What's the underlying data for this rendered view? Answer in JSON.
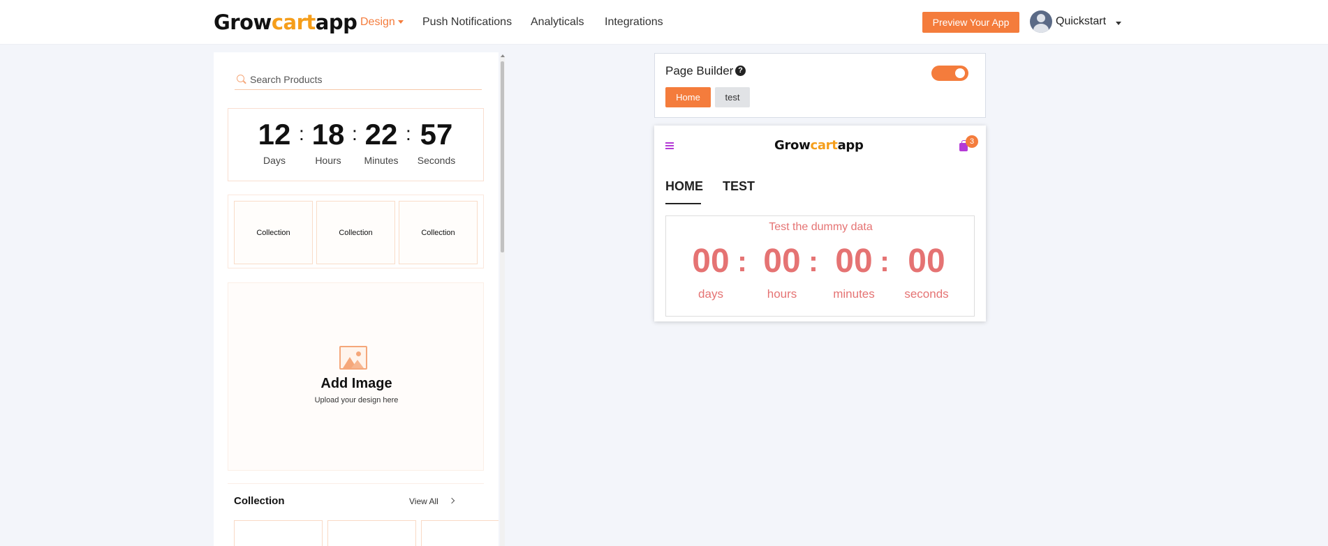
{
  "nav": {
    "logo_a": "Grow",
    "logo_b": "cart",
    "logo_c": "app",
    "links": [
      {
        "label": "Design",
        "active": true
      },
      {
        "label": "Push Notifications"
      },
      {
        "label": "Analyticals"
      },
      {
        "label": "Integrations"
      }
    ],
    "preview_button": "Preview Your App",
    "user_name": "Quickstart"
  },
  "left_panel": {
    "search_placeholder": "Search Products",
    "countdown": {
      "values": [
        "12",
        "18",
        "22",
        "57"
      ],
      "labels": [
        "Days",
        "Hours",
        "Minutes",
        "Seconds"
      ],
      "separator": ":"
    },
    "collection_boxes": [
      "Collection",
      "Collection",
      "Collection"
    ],
    "add_image": {
      "title": "Add Image",
      "subtitle": "Upload your design here"
    },
    "collection_section": {
      "title": "Collection",
      "view_all": "View All"
    }
  },
  "page_builder": {
    "title": "Page Builder",
    "help_glyph": "?",
    "toggle_on": true,
    "tabs": [
      "Home",
      "test"
    ]
  },
  "phone": {
    "logo_a": "Grow",
    "logo_b": "cart",
    "logo_c": "app",
    "cart_count": "3",
    "tabs": [
      "HOME",
      "TEST"
    ],
    "timer": {
      "title": "Test the dummy data",
      "values": [
        "00",
        "00",
        "00",
        "00"
      ],
      "labels": [
        "days",
        "hours",
        "minutes",
        "seconds"
      ],
      "separator": ":"
    }
  },
  "colors": {
    "accent": "#f47c3c",
    "logo_accent": "#f59e1b",
    "timer_text": "#e57373",
    "icon_purple": "#b43ad6"
  }
}
